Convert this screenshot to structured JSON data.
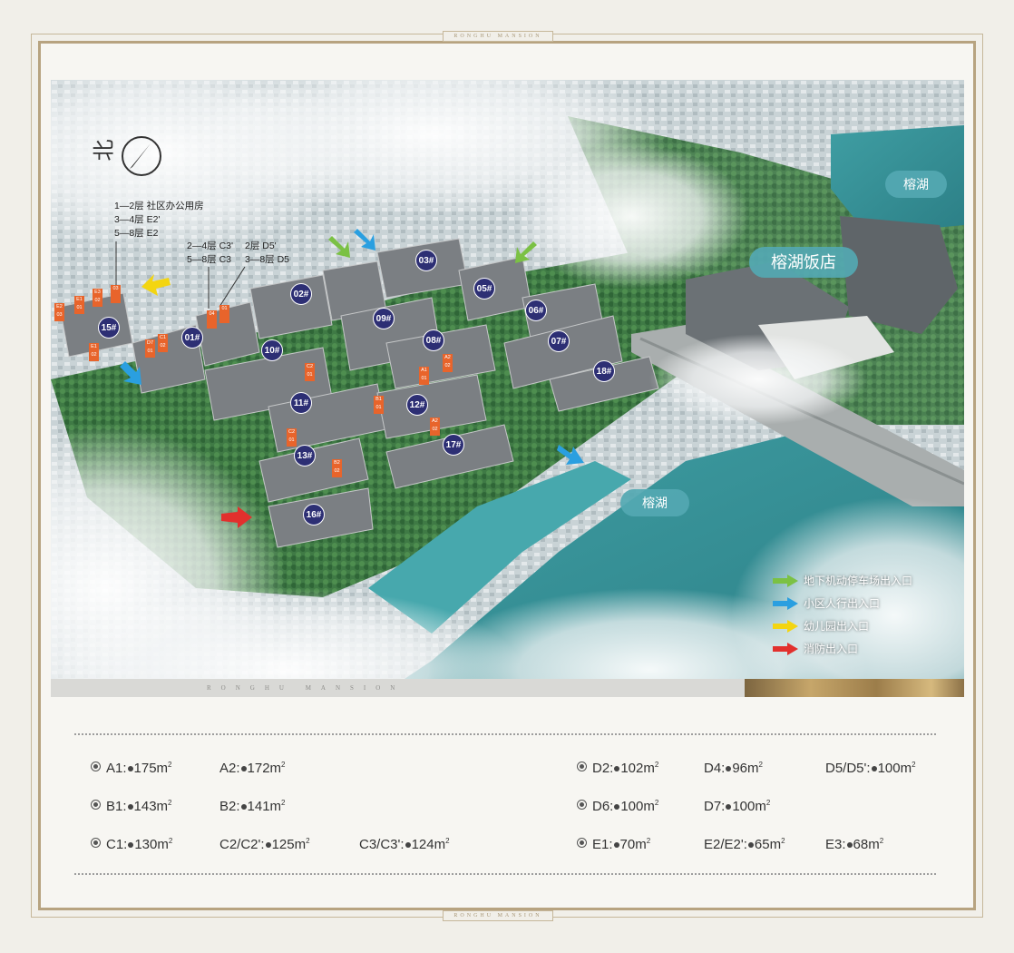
{
  "frame": {
    "top_tag": "RONGHU MANSION",
    "bottom_tag": "RONGHU MANSION"
  },
  "map": {
    "compass_label": "北",
    "places": {
      "lake_top": "榕湖",
      "lake_main": "榕湖",
      "hotel": "榕湖饭店"
    },
    "annotations": {
      "left": [
        "1—2层 社区办公用房",
        "3—4层 E2'",
        "5—8层 E2"
      ],
      "mid": [
        "2—4层 C3'",
        "5—8层 C3"
      ],
      "right": [
        "2层 D5'",
        "3—8层 D5"
      ]
    },
    "buildings": [
      "01#",
      "02#",
      "03#",
      "05#",
      "06#",
      "07#",
      "08#",
      "09#",
      "10#",
      "11#",
      "12#",
      "13#",
      "15#",
      "16#",
      "17#",
      "18#"
    ],
    "legend": [
      {
        "label": "地下机动停车场出入口",
        "color": "#7bc144"
      },
      {
        "label": "小区人行出入口",
        "color": "#2a9fe0"
      },
      {
        "label": "幼儿园出入口",
        "color": "#f3d511"
      },
      {
        "label": "消防出入口",
        "color": "#e2302d"
      }
    ],
    "strip_text": "RONGHU MANSION"
  },
  "specs": [
    {
      "code": "A1:",
      "area": "175m",
      "sup": "2"
    },
    {
      "code": "A2:",
      "area": "172m",
      "sup": "2"
    },
    {
      "code": "B1:",
      "area": "143m",
      "sup": "2"
    },
    {
      "code": "B2:",
      "area": "141m",
      "sup": "2"
    },
    {
      "code": "C1:",
      "area": "130m",
      "sup": "2"
    },
    {
      "code": "C2/C2':",
      "area": "125m",
      "sup": "2"
    },
    {
      "code": "C3/C3':",
      "area": "124m",
      "sup": "2"
    },
    {
      "code": "D2:",
      "area": "102m",
      "sup": "2"
    },
    {
      "code": "D4:",
      "area": "96m",
      "sup": "2"
    },
    {
      "code": "D5/D5':",
      "area": "100m",
      "sup": "2"
    },
    {
      "code": "D6:",
      "area": "100m",
      "sup": "2"
    },
    {
      "code": "D7:",
      "area": "100m",
      "sup": "2"
    },
    {
      "code": "E1:",
      "area": "70m",
      "sup": "2"
    },
    {
      "code": "E2/E2':",
      "area": "65m",
      "sup": "2"
    },
    {
      "code": "E3:",
      "area": "68m",
      "sup": "2"
    }
  ]
}
